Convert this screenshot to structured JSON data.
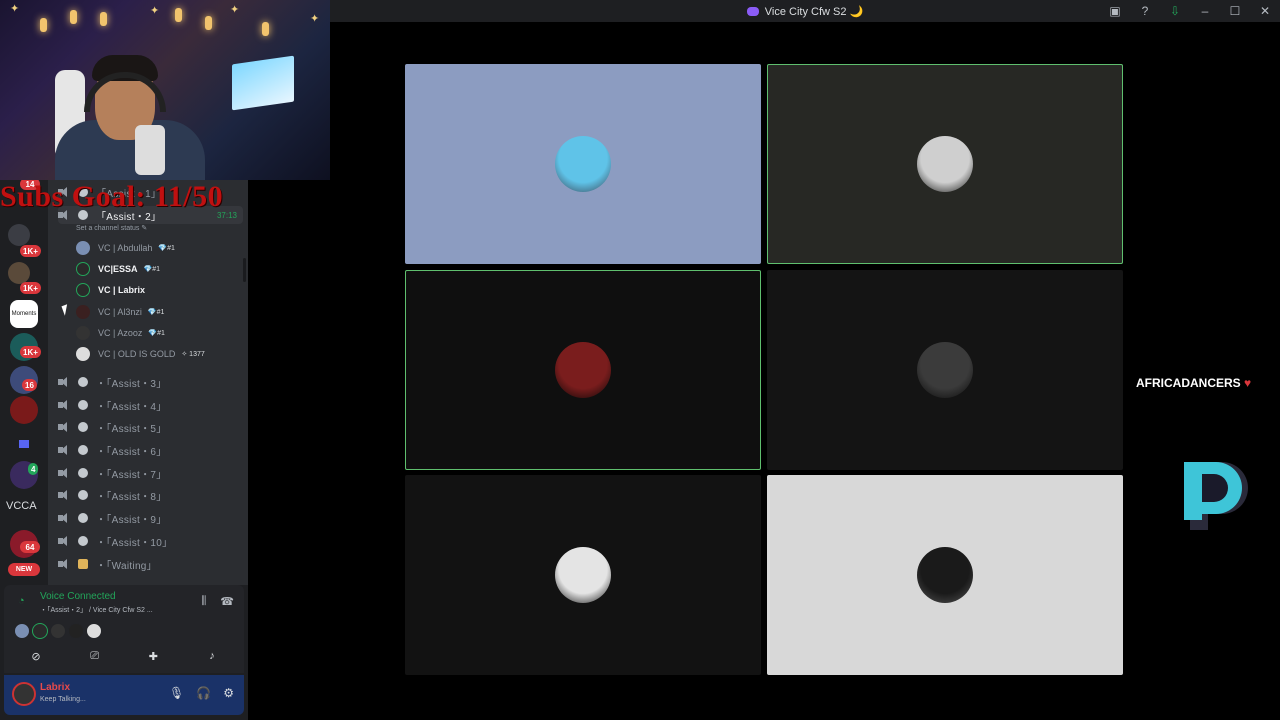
{
  "window": {
    "title": "Vice City Cfw S2 🌙"
  },
  "overlay": {
    "subs_goal": "Subs Goal: 11/50",
    "sponsor_text": "AFRICADANCERS",
    "sponsor_heart": "♥"
  },
  "servers": {
    "badges": [
      "14",
      "1K+",
      "1K+",
      "1K+",
      "1K+",
      "16",
      "64",
      "4"
    ],
    "moments_label": "Moments",
    "vcca_label": "VCCA",
    "new_label": "NEW"
  },
  "channels": {
    "assist_1": "「Assist・1」",
    "assist_2": "「Assist・2」",
    "assist_2_time": "37:13",
    "set_status": "Set a channel status ✎",
    "members": [
      {
        "name": "VC | Abdullah",
        "tag": "💎#1"
      },
      {
        "name": "VC|ESSA",
        "tag": "💎#1"
      },
      {
        "name": "VC | Labrix",
        "tag": ""
      },
      {
        "name": "VC | Al3nzi",
        "tag": "💎#1"
      },
      {
        "name": "VC | Azooz",
        "tag": "💎#1"
      },
      {
        "name": "VC | OLD IS GOLD",
        "tag": "✧ 1377"
      }
    ],
    "list": [
      "・「Assist・3」",
      "・「Assist・4」",
      "・「Assist・5」",
      "・「Assist・6」",
      "・「Assist・7」",
      "・「Assist・8」",
      "・「Assist・9」",
      "・「Assist・10」",
      "・「Waiting」"
    ]
  },
  "voice": {
    "title": "Voice Connected",
    "subtitle": "・「Assist・2」 / Vice City Cfw S2 ...",
    "user_name": "Labrix",
    "user_status": "Keep Talking..."
  },
  "tiles": [
    {
      "bg": "#8c9cc1",
      "speaking": false,
      "avatar": "#5fc3e8"
    },
    {
      "bg": "#272824",
      "speaking": true,
      "avatar": "#cfcfcf"
    },
    {
      "bg": "#0f0f0f",
      "speaking": true,
      "avatar": "#7a1d1d"
    },
    {
      "bg": "#141414",
      "speaking": false,
      "avatar": "#3b3b3b"
    },
    {
      "bg": "#121212",
      "speaking": false,
      "avatar": "#e4e4e4"
    },
    {
      "bg": "#d8d8d8",
      "speaking": false,
      "avatar": "#1a1a1a"
    }
  ],
  "colors": {
    "accent_green": "#23a55a",
    "badge_red": "#da373c",
    "logo_cyan": "#3ec5d8"
  }
}
